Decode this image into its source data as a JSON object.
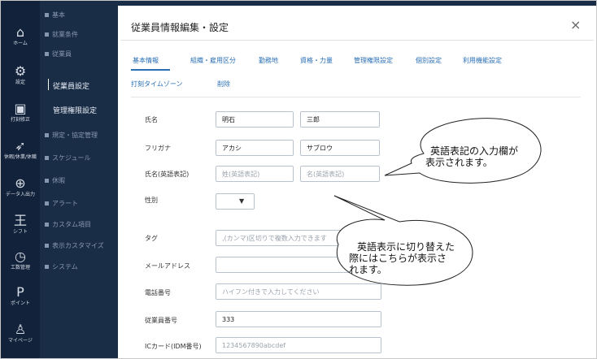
{
  "rail": [
    {
      "icon": "home-icon",
      "glyph": "⌂",
      "label": "ホーム"
    },
    {
      "icon": "gear-icon",
      "glyph": "⚙",
      "label": "設定"
    },
    {
      "icon": "clipboard-icon",
      "glyph": "▣",
      "label": "打刻修正"
    },
    {
      "icon": "send-icon",
      "glyph": "➶",
      "label": "休暇/休業/休職"
    },
    {
      "icon": "download-icon",
      "glyph": "⊕",
      "label": "データ入出力"
    },
    {
      "icon": "shift-icon",
      "glyph": "王",
      "label": "シフト"
    },
    {
      "icon": "clock-icon",
      "glyph": "◷",
      "label": "工数管理"
    },
    {
      "icon": "points-icon",
      "glyph": "P",
      "label": "ポイント"
    },
    {
      "icon": "user-icon",
      "glyph": "♙",
      "label": "マイページ"
    }
  ],
  "subnav": {
    "items": [
      "基本",
      "就業条件",
      "従業員"
    ],
    "children": [
      "従業員設定",
      "管理権限設定"
    ],
    "items2": [
      "規定・協定管理",
      "スケジュール",
      "休暇",
      "アラート",
      "カスタム項目",
      "表示カスタマイズ",
      "システム"
    ]
  },
  "modal": {
    "title": "従業員情報編集・設定",
    "close": "×",
    "tabs": [
      "基本情報",
      "組織・雇用区分",
      "勤務地",
      "資格・力量",
      "管理権限設定",
      "個別設定",
      "利用機能設定"
    ],
    "tabs2": [
      "打刻タイムゾーン",
      "削除"
    ]
  },
  "form": {
    "name_label": "氏名",
    "last_name": "明石",
    "first_name": "三郎",
    "kana_label": "フリガナ",
    "last_kana": "アカシ",
    "first_kana": "サブロウ",
    "en_label": "氏名(英語表記)",
    "en_last_ph": "姓(英語表記)",
    "en_first_ph": "名(英語表記)",
    "gender_label": "性別",
    "gender_value": "▼",
    "tag_label": "タグ",
    "tag_ph": ",(カンマ)区切りで複数入力できます",
    "mail_label": "メールアドレス",
    "mail_value": "",
    "phone_label": "電話番号",
    "phone_ph": "ハイフン付きで入力してください",
    "empno_label": "従業員番号",
    "empno_value": "333",
    "ic_label": "ICカード(IDM番号)",
    "ic_ph": "1234567890abcdef"
  },
  "callouts": {
    "c1_line1": "英語表記の入力欄が",
    "c1_line2": "表示されます。",
    "c2_line1": "英語表示に切り替えた",
    "c2_line2": "際にはこちらが表示さ",
    "c2_line3": "れます。"
  }
}
